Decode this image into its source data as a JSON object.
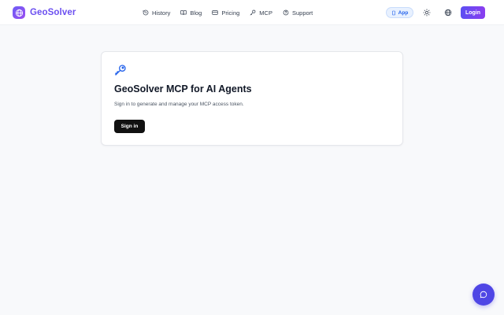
{
  "brand": {
    "name": "GeoSolver",
    "logo_icon": "globe-icon",
    "color": "#6b4ff0"
  },
  "nav": {
    "items": [
      {
        "label": "History",
        "icon": "history-icon"
      },
      {
        "label": "Blog",
        "icon": "book-icon"
      },
      {
        "label": "Pricing",
        "icon": "card-icon"
      },
      {
        "label": "MCP",
        "icon": "key-icon"
      },
      {
        "label": "Support",
        "icon": "help-circle-icon"
      }
    ]
  },
  "header": {
    "app_label": "App",
    "app_icon": "phone-icon",
    "theme_icon": "sun-icon",
    "language_icon": "globe-icon",
    "login_label": "Login"
  },
  "card": {
    "icon": "key-icon",
    "title": "GeoSolver MCP for AI Agents",
    "description": "Sign in to generate and manage your MCP access token.",
    "signin_label": "Sign in"
  },
  "chat": {
    "icon": "chat-bubble-icon",
    "color": "#4f46e5"
  }
}
